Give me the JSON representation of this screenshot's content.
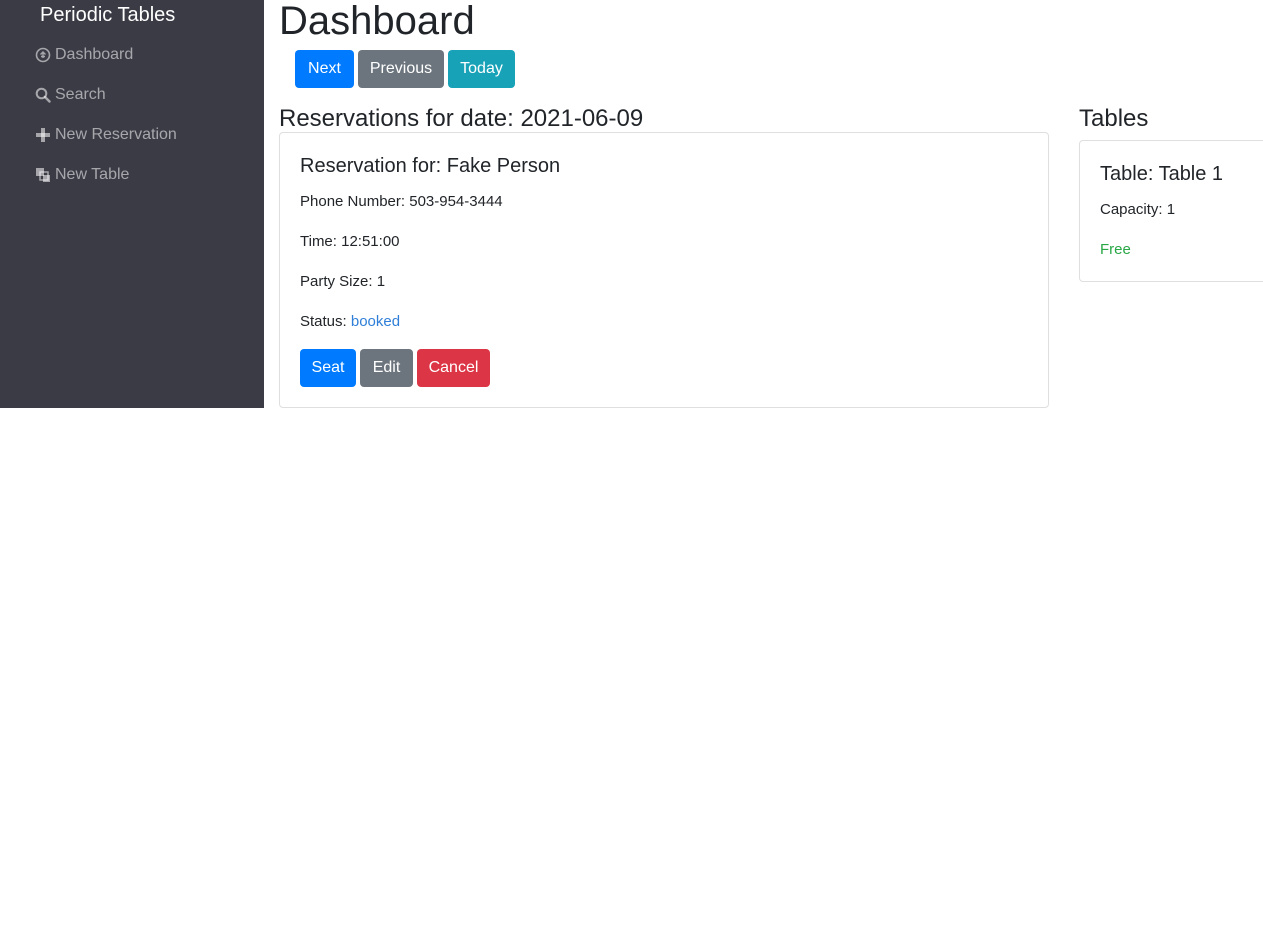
{
  "sidebar": {
    "brand": "Periodic Tables",
    "items": [
      {
        "label": "Dashboard",
        "icon": "dashboard-icon"
      },
      {
        "label": "Search",
        "icon": "search-icon"
      },
      {
        "label": "New Reservation",
        "icon": "plus-icon"
      },
      {
        "label": "New Table",
        "icon": "layers-icon"
      }
    ]
  },
  "header": {
    "title": "Dashboard"
  },
  "date_nav": {
    "next": "Next",
    "previous": "Previous",
    "today": "Today"
  },
  "reservations": {
    "heading": "Reservations for date: 2021-06-09",
    "items": [
      {
        "title": "Reservation for: Fake Person",
        "phone": "Phone Number: 503-954-3444",
        "time": "Time: 12:51:00",
        "party_size": "Party Size: 1",
        "status_label": "Status: ",
        "status_value": "booked",
        "actions": {
          "seat": "Seat",
          "edit": "Edit",
          "cancel": "Cancel"
        }
      }
    ]
  },
  "tables": {
    "heading": "Tables",
    "items": [
      {
        "title": "Table: Table 1",
        "capacity": "Capacity: 1",
        "status": "Free"
      }
    ]
  },
  "colors": {
    "sidebar_bg": "#3a3b45",
    "primary": "#007bff",
    "secondary": "#6c757d",
    "info": "#17a2b8",
    "danger": "#dc3545",
    "status_link": "#2f7fd8",
    "free": "#28a745"
  }
}
